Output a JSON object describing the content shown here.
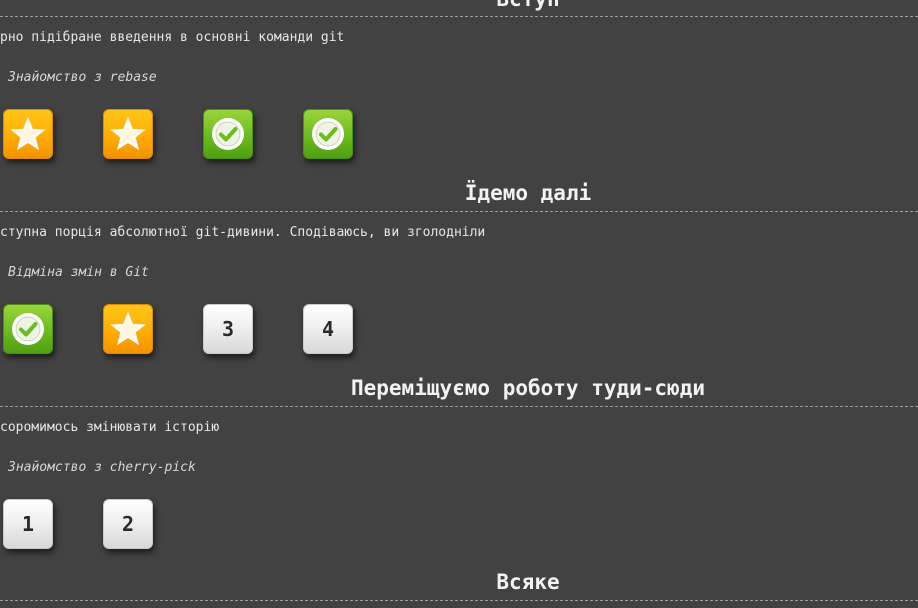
{
  "sections": [
    {
      "title": "Вступ",
      "description": "рно підібране введення в основні команди git",
      "current_level": "Знайомство з rebase",
      "levels": [
        {
          "state": "star",
          "icon": "star-icon"
        },
        {
          "state": "star",
          "icon": "star-icon"
        },
        {
          "state": "done",
          "icon": "checkmark-icon"
        },
        {
          "state": "done",
          "icon": "checkmark-icon"
        }
      ]
    },
    {
      "title": "Їдемо далі",
      "description": "ступна порція абсолютної git-дивини. Сподіваюсь, ви зголодніли",
      "current_level": "Відміна змін в Git",
      "levels": [
        {
          "state": "done",
          "icon": "checkmark-icon"
        },
        {
          "state": "star",
          "icon": "star-icon"
        },
        {
          "state": "num",
          "label": "3"
        },
        {
          "state": "num",
          "label": "4"
        }
      ]
    },
    {
      "title": "Переміщуємо роботу туди-сюди",
      "description": " соромимось змінювати історію",
      "current_level": "Знайомство з cherry-pick",
      "levels": [
        {
          "state": "num",
          "label": "1"
        },
        {
          "state": "num",
          "label": "2"
        }
      ]
    },
    {
      "title": "Всяке"
    }
  ],
  "colors": {
    "background": "#424242",
    "star_level": "#ffad00",
    "done_level": "#6cbb1f",
    "number_level": "#f0f0f0"
  }
}
